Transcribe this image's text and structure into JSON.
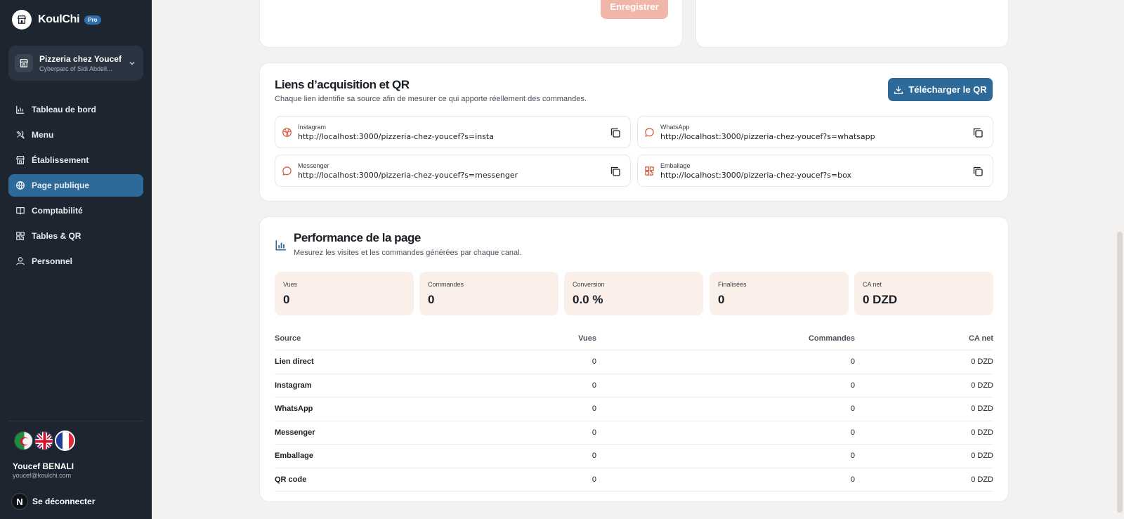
{
  "brand": {
    "name": "KoulChi",
    "badge": "Pro"
  },
  "establishment": {
    "name": "Pizzeria chez Youcef",
    "address": "Cyberparc of Sidi Abdell..."
  },
  "nav": [
    {
      "label": "Tableau de bord",
      "icon": "chart-icon"
    },
    {
      "label": "Menu",
      "icon": "menu-icon"
    },
    {
      "label": "Établissement",
      "icon": "store-icon"
    },
    {
      "label": "Page publique",
      "icon": "globe-icon",
      "active": true
    },
    {
      "label": "Comptabilité",
      "icon": "book-icon"
    },
    {
      "label": "Tables & QR",
      "icon": "qr-icon"
    },
    {
      "label": "Personnel",
      "icon": "user-icon"
    }
  ],
  "user": {
    "name": "Youcef BENALI",
    "email": "youcef@koulchi.com",
    "avatar_letter": "N",
    "logout": "Se déconnecter"
  },
  "top_card": {
    "save_label": "Enregistrer"
  },
  "acquisition": {
    "title": "Liens d’acquisition et QR",
    "subtitle": "Chaque lien identifie sa source afin de mesurer ce qui apporte réellement des commandes.",
    "download_label": "Télécharger le QR",
    "links": [
      {
        "name": "Instagram",
        "url": "http://localhost:3000/pizzeria-chez-youcef?s=insta",
        "icon": "instagram-icon"
      },
      {
        "name": "WhatsApp",
        "url": "http://localhost:3000/pizzeria-chez-youcef?s=whatsapp",
        "icon": "whatsapp-icon"
      },
      {
        "name": "Messenger",
        "url": "http://localhost:3000/pizzeria-chez-youcef?s=messenger",
        "icon": "messenger-icon"
      },
      {
        "name": "Emballage",
        "url": "http://localhost:3000/pizzeria-chez-youcef?s=box",
        "icon": "qr-icon"
      }
    ]
  },
  "performance": {
    "title": "Performance de la page",
    "subtitle": "Mesurez les visites et les commandes générées par chaque canal.",
    "stats": [
      {
        "label": "Vues",
        "value": "0"
      },
      {
        "label": "Commandes",
        "value": "0"
      },
      {
        "label": "Conversion",
        "value": "0.0 %"
      },
      {
        "label": "Finalisées",
        "value": "0"
      },
      {
        "label": "CA net",
        "value": "0 DZD"
      }
    ],
    "table": {
      "headers": [
        "Source",
        "Vues",
        "Commandes",
        "CA net"
      ],
      "rows": [
        [
          "Lien direct",
          "0",
          "0",
          "0 DZD"
        ],
        [
          "Instagram",
          "0",
          "0",
          "0 DZD"
        ],
        [
          "WhatsApp",
          "0",
          "0",
          "0 DZD"
        ],
        [
          "Messenger",
          "0",
          "0",
          "0 DZD"
        ],
        [
          "Emballage",
          "0",
          "0",
          "0 DZD"
        ],
        [
          "QR code",
          "0",
          "0",
          "0 DZD"
        ]
      ]
    }
  },
  "colors": {
    "accent": "#2d6a99",
    "sidebar": "#1c2530",
    "save_disabled": "#f0b6a9",
    "stat_bg": "#fbefea"
  }
}
